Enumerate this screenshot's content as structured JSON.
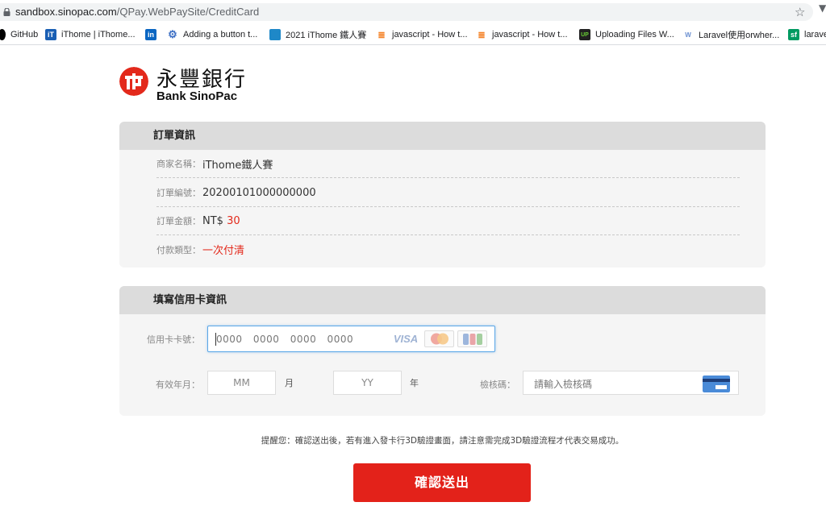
{
  "browser": {
    "url_host": "sandbox.sinopac.com",
    "url_path": "/QPay.WebPaySite/CreditCard",
    "bookmarks": [
      {
        "label": "GitHub",
        "icon": "github-icon"
      },
      {
        "label": "iThome | iThome...",
        "icon": "ithome-icon"
      },
      {
        "label": "",
        "icon": "linkedin-icon"
      },
      {
        "label": "Adding a button t...",
        "icon": "gear-icon"
      },
      {
        "label": "2021 iThome 鐵人賽",
        "icon": "ithome-ironman-icon"
      },
      {
        "label": "javascript - How t...",
        "icon": "stackoverflow-icon"
      },
      {
        "label": "javascript - How t...",
        "icon": "stackoverflow-icon"
      },
      {
        "label": "Uploading Files W...",
        "icon": "upload-icon"
      },
      {
        "label": "Laravel使用orwher...",
        "icon": "site-icon"
      },
      {
        "label": "larave",
        "icon": "segmentfault-icon"
      }
    ]
  },
  "logo": {
    "chinese": "永豐銀行",
    "english": "Bank SinoPac",
    "brand_color": "#e3291b"
  },
  "order": {
    "title": "訂單資訊",
    "rows": [
      {
        "label": "商家名稱：",
        "value": "iThome鐵人賽"
      },
      {
        "label": "訂單編號：",
        "value": "20200101000000000"
      },
      {
        "label": "訂單金額：",
        "value_prefix": "NT$ ",
        "value": "30"
      },
      {
        "label": "付款類型：",
        "value": "一次付清"
      }
    ]
  },
  "card": {
    "title": "填寫信用卡資訊",
    "number_label": "信用卡卡號：",
    "number_placeholder": "0000 0000 0000 0000",
    "brands": [
      "VISA",
      "MasterCard",
      "JCB"
    ],
    "expiry_label": "有效年月：",
    "month_placeholder": "MM",
    "month_unit": "月",
    "year_placeholder": "YY",
    "year_unit": "年",
    "cvv_label": "檢核碼：",
    "cvv_placeholder": "請輸入檢核碼",
    "cvv_icon": "card-back-icon"
  },
  "notice": "提醒您：確認送出後，若有進入發卡行3D驗證畫面，請注意需完成3D驗證流程才代表交易成功。",
  "submit_label": "確認送出",
  "accent_color": "#e3221a",
  "focus_color": "#5aa6e6"
}
